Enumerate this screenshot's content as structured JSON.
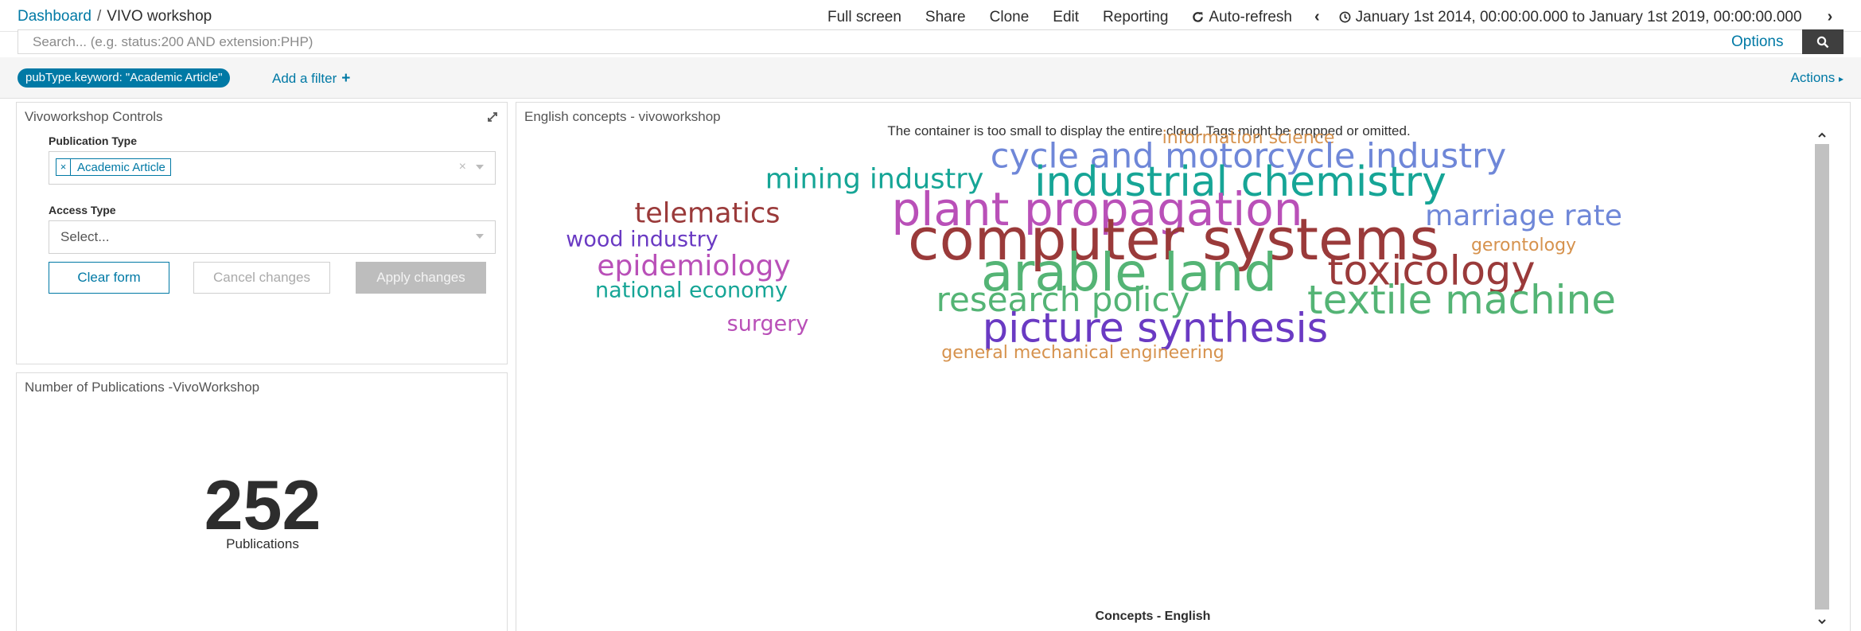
{
  "breadcrumb": {
    "root": "Dashboard",
    "separator": "/",
    "current": "VIVO workshop"
  },
  "topmenu": {
    "full_screen": "Full screen",
    "share": "Share",
    "clone": "Clone",
    "edit": "Edit",
    "reporting": "Reporting",
    "auto_refresh": "Auto-refresh",
    "time_range": "January 1st 2014, 00:00:00.000 to January 1st 2019, 00:00:00.000"
  },
  "search": {
    "placeholder": "Search... (e.g. status:200 AND extension:PHP)",
    "options_label": "Options"
  },
  "filters": {
    "active": "pubType.keyword: \"Academic Article\"",
    "add_label": "Add a filter",
    "actions_label": "Actions"
  },
  "controls_panel": {
    "title": "Vivoworkshop Controls",
    "publication_type_label": "Publication Type",
    "publication_type_selected": "Academic Article",
    "access_type_label": "Access Type",
    "access_type_placeholder": "Select...",
    "clear_label": "Clear form",
    "cancel_label": "Cancel changes",
    "apply_label": "Apply changes"
  },
  "count_panel": {
    "title": "Number of Publications -VivoWorkshop",
    "value": "252",
    "label": "Publications"
  },
  "cloud_panel": {
    "title": "English concepts - vivoworkshop",
    "warning": "The container is too small to display the entire cloud. Tags might be cropped or omitted.",
    "caption": "Concepts - English",
    "words": [
      {
        "text": "information science",
        "color": "#d6924d",
        "weight": 22
      },
      {
        "text": "cycle and motorcycle industry",
        "color": "#6f87d8",
        "weight": 43
      },
      {
        "text": "mining industry",
        "color": "#16a596",
        "weight": 35
      },
      {
        "text": "industrial chemistry",
        "color": "#16a596",
        "weight": 52
      },
      {
        "text": "telematics",
        "color": "#9a3a3a",
        "weight": 35
      },
      {
        "text": "plant propagation",
        "color": "#b950b8",
        "weight": 58
      },
      {
        "text": "marriage rate",
        "color": "#6f87d8",
        "weight": 36
      },
      {
        "text": "wood industry",
        "color": "#6a3ac3",
        "weight": 27
      },
      {
        "text": "computer systems",
        "color": "#9a3a3a",
        "weight": 72
      },
      {
        "text": "gerontology",
        "color": "#d6924d",
        "weight": 22
      },
      {
        "text": "epidemiology",
        "color": "#b950b8",
        "weight": 36
      },
      {
        "text": "arable land",
        "color": "#54b475",
        "weight": 66
      },
      {
        "text": "toxicology",
        "color": "#9a3a3a",
        "weight": 51
      },
      {
        "text": "national economy",
        "color": "#16a596",
        "weight": 27
      },
      {
        "text": "research policy",
        "color": "#54b475",
        "weight": 42
      },
      {
        "text": "textile machine",
        "color": "#54b475",
        "weight": 50
      },
      {
        "text": "surgery",
        "color": "#b950b8",
        "weight": 27
      },
      {
        "text": "picture synthesis",
        "color": "#6a3ac3",
        "weight": 51
      },
      {
        "text": "general mechanical engineering",
        "color": "#d6924d",
        "weight": 22
      }
    ]
  },
  "colors": {
    "accent": "#0079a5",
    "search_button": "#3f3f3f",
    "apply_disabled": "#bdbdbd"
  }
}
